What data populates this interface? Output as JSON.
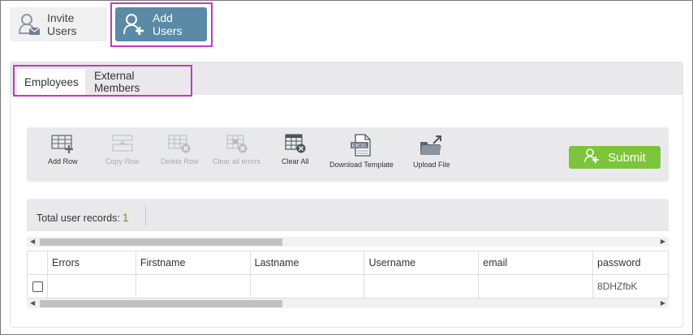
{
  "top_tabs": {
    "invite_label": "Invite Users",
    "add_label": "Add Users"
  },
  "sub_tabs": {
    "employees": "Employees",
    "external": "External Members"
  },
  "toolbar": {
    "add_row": "Add Row",
    "copy_row": "Copy Row",
    "delete_row": "Delete Row",
    "clear_errors": "Clear all errors",
    "clear_all": "Clear All",
    "download_template": "Download Template",
    "upload_file": "Upload File",
    "submit": "Submit"
  },
  "records": {
    "label": "Total user records:",
    "count": "1"
  },
  "grid": {
    "columns": [
      "Errors",
      "Firstname",
      "Lastname",
      "Username",
      "email",
      "password"
    ],
    "rows": [
      [
        "",
        "",
        "",
        "",
        "",
        "8DHZfbK"
      ]
    ]
  },
  "colors": {
    "accent": "#5a8aa5",
    "submit": "#7cc53a",
    "highlight": "#c13ac1"
  }
}
